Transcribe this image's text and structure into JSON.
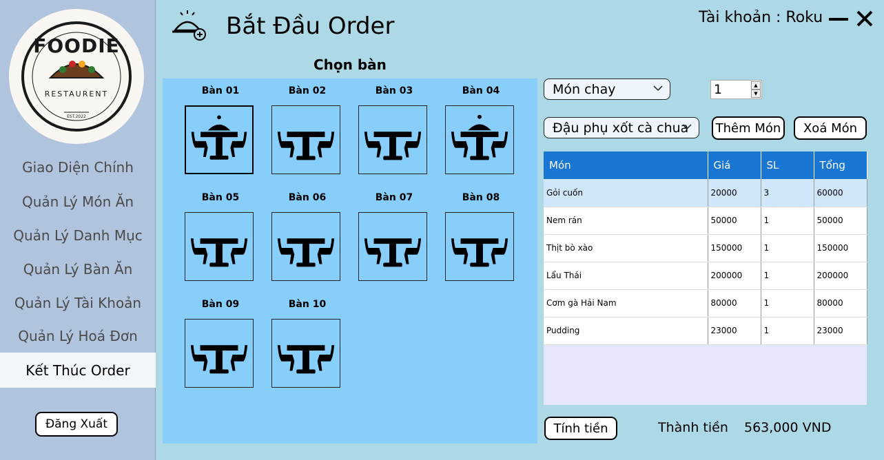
{
  "sidebar": {
    "logo": {
      "title": "FOODIE",
      "subtitle": "RESTAURENT",
      "est": "EST.2022"
    },
    "items": [
      {
        "label": "Giao Diện Chính"
      },
      {
        "label": "Quản Lý Món Ăn"
      },
      {
        "label": "Quản Lý Danh Mục"
      },
      {
        "label": "Quản Lý Bàn Ăn"
      },
      {
        "label": "Quản Lý Tài Khoản"
      },
      {
        "label": "Quản Lý Hoá Đơn"
      },
      {
        "label": "Kết Thúc Order"
      }
    ],
    "active_index": 6,
    "logout_label": "Đăng Xuất"
  },
  "header": {
    "title": "Bắt Đầu Order",
    "account": "Tài khoản : Roku"
  },
  "tables_panel": {
    "title": "Chọn bàn",
    "tables": [
      {
        "label": "Bàn 01",
        "status": "occupied"
      },
      {
        "label": "Bàn 02",
        "status": "empty"
      },
      {
        "label": "Bàn 03",
        "status": "empty"
      },
      {
        "label": "Bàn 04",
        "status": "occupied"
      },
      {
        "label": "Bàn 05",
        "status": "empty"
      },
      {
        "label": "Bàn 06",
        "status": "empty"
      },
      {
        "label": "Bàn 07",
        "status": "empty"
      },
      {
        "label": "Bàn 08",
        "status": "empty"
      },
      {
        "label": "Bàn 09",
        "status": "empty"
      },
      {
        "label": "Bàn 10",
        "status": "empty"
      }
    ]
  },
  "order_form": {
    "category_value": "Món chay",
    "quantity_value": "1",
    "dish_value": "Đậu phụ xốt cà chua",
    "add_label": "Thêm Món",
    "remove_label": "Xoá Món"
  },
  "order_table": {
    "columns": [
      "Món",
      "Giá",
      "SL",
      "Tổng"
    ],
    "rows": [
      [
        "Gỏi cuốn",
        "20000",
        "3",
        "60000"
      ],
      [
        "Nem rán",
        "50000",
        "1",
        "50000"
      ],
      [
        "Thịt bò xào",
        "150000",
        "1",
        "150000"
      ],
      [
        "Lẩu Thái",
        "200000",
        "1",
        "200000"
      ],
      [
        "Cơm gà Hải Nam",
        "80000",
        "1",
        "80000"
      ],
      [
        "Pudding",
        "23000",
        "1",
        "23000"
      ]
    ]
  },
  "footer": {
    "checkout_label": "Tính tiền",
    "total_label": "Thành tiền",
    "total_value": "563,000 VND"
  },
  "colors": {
    "background": "#add8e6",
    "sidebar": "#b0c4de",
    "table_panel": "#87cefa",
    "grid_header": "#1976d2"
  }
}
